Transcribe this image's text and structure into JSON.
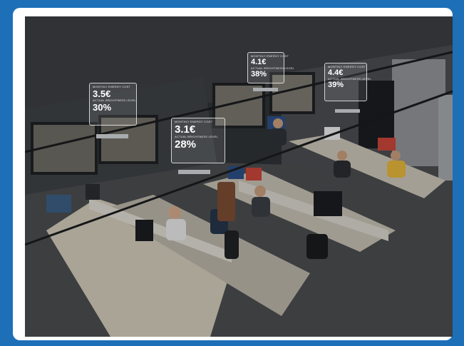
{
  "overlays": [
    {
      "id": "left",
      "cost_label": "MONTHLY ENERGY COST",
      "cost": "3.5€",
      "light_label": "ACTUAL BRIGHTNESS LEVEL",
      "light": "30%"
    },
    {
      "id": "center",
      "cost_label": "MONTHLY ENERGY COST",
      "cost": "3.1€",
      "light_label": "ACTUAL BRIGHTNESS LEVEL",
      "light": "28%"
    },
    {
      "id": "top",
      "cost_label": "MONTHLY ENERGY COST",
      "cost": "4.1€",
      "light_label": "ACTUAL BRIGHTNESS LEVEL",
      "light": "38%"
    },
    {
      "id": "right",
      "cost_label": "MONTHLY ENERGY COST",
      "cost": "4.4€",
      "light_label": "ACTUAL BRIGHTNESS LEVEL",
      "light": "39%"
    }
  ]
}
